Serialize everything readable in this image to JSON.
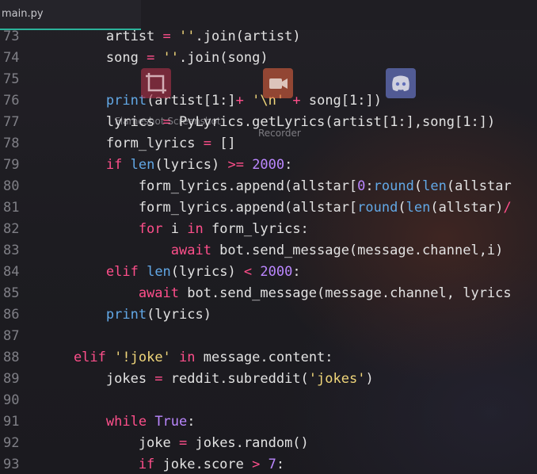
{
  "tab": {
    "filename": "main.py"
  },
  "desktop_icons": [
    {
      "name": "crop-icon",
      "label": "Flameshot Screenshot"
    },
    {
      "name": "camera-icon",
      "label": "Recorder"
    },
    {
      "name": "discord-icon",
      "label": ""
    }
  ],
  "lines": [
    {
      "num": "73",
      "segs": [
        [
          "var",
          "        artist "
        ],
        [
          "op",
          "="
        ],
        [
          "str",
          " ''"
        ],
        [
          "var",
          ".join(artist)"
        ]
      ]
    },
    {
      "num": "74",
      "segs": [
        [
          "var",
          "        song "
        ],
        [
          "op",
          "="
        ],
        [
          "str",
          " ''"
        ],
        [
          "var",
          ".join(song)"
        ]
      ]
    },
    {
      "num": "75",
      "segs": [
        [
          "var",
          ""
        ]
      ]
    },
    {
      "num": "76",
      "segs": [
        [
          "fn",
          "        print"
        ],
        [
          "var",
          "(artist[1:]"
        ],
        [
          "op",
          "+"
        ],
        [
          "var",
          " "
        ],
        [
          "str",
          "'\\n'"
        ],
        [
          "var",
          " "
        ],
        [
          "op",
          "+"
        ],
        [
          "var",
          " song[1:])"
        ]
      ]
    },
    {
      "num": "77",
      "segs": [
        [
          "var",
          "        lyrics "
        ],
        [
          "op",
          "="
        ],
        [
          "var",
          " PyLyrics.getLyrics(artist[1:],song[1:])"
        ]
      ]
    },
    {
      "num": "78",
      "segs": [
        [
          "var",
          "        form_lyrics "
        ],
        [
          "op",
          "="
        ],
        [
          "var",
          " []"
        ]
      ]
    },
    {
      "num": "79",
      "segs": [
        [
          "kw",
          "        if"
        ],
        [
          "var",
          " "
        ],
        [
          "fn",
          "len"
        ],
        [
          "var",
          "(lyrics) "
        ],
        [
          "op",
          ">="
        ],
        [
          "var",
          " "
        ],
        [
          "num",
          "2000"
        ],
        [
          "var",
          ":"
        ]
      ]
    },
    {
      "num": "80",
      "segs": [
        [
          "var",
          "            form_lyrics.append(allstar["
        ],
        [
          "num",
          "0"
        ],
        [
          "var",
          ":"
        ],
        [
          "fn",
          "round"
        ],
        [
          "var",
          "("
        ],
        [
          "fn",
          "len"
        ],
        [
          "var",
          "(allstar"
        ]
      ]
    },
    {
      "num": "81",
      "segs": [
        [
          "var",
          "            form_lyrics.append(allstar["
        ],
        [
          "fn",
          "round"
        ],
        [
          "var",
          "("
        ],
        [
          "fn",
          "len"
        ],
        [
          "var",
          "(allstar)"
        ],
        [
          "op",
          "/"
        ]
      ]
    },
    {
      "num": "82",
      "segs": [
        [
          "kw",
          "            for"
        ],
        [
          "var",
          " i "
        ],
        [
          "kw",
          "in"
        ],
        [
          "var",
          " form_lyrics:"
        ]
      ]
    },
    {
      "num": "83",
      "segs": [
        [
          "kw",
          "                await"
        ],
        [
          "var",
          " bot.send_message(message.channel,i)"
        ]
      ]
    },
    {
      "num": "84",
      "segs": [
        [
          "kw",
          "        elif"
        ],
        [
          "var",
          " "
        ],
        [
          "fn",
          "len"
        ],
        [
          "var",
          "(lyrics) "
        ],
        [
          "op",
          "<"
        ],
        [
          "var",
          " "
        ],
        [
          "num",
          "2000"
        ],
        [
          "var",
          ":"
        ]
      ]
    },
    {
      "num": "85",
      "segs": [
        [
          "kw",
          "            await"
        ],
        [
          "var",
          " bot.send_message(message.channel, lyrics"
        ]
      ]
    },
    {
      "num": "86",
      "segs": [
        [
          "fn",
          "        print"
        ],
        [
          "var",
          "(lyrics)"
        ]
      ]
    },
    {
      "num": "87",
      "segs": [
        [
          "var",
          ""
        ]
      ]
    },
    {
      "num": "88",
      "segs": [
        [
          "kw",
          "    elif"
        ],
        [
          "var",
          " "
        ],
        [
          "str",
          "'!joke'"
        ],
        [
          "var",
          " "
        ],
        [
          "kw",
          "in"
        ],
        [
          "var",
          " message.content:"
        ]
      ]
    },
    {
      "num": "89",
      "segs": [
        [
          "var",
          "        jokes "
        ],
        [
          "op",
          "="
        ],
        [
          "var",
          " reddit.subreddit("
        ],
        [
          "str",
          "'jokes'"
        ],
        [
          "var",
          ")"
        ]
      ]
    },
    {
      "num": "90",
      "segs": [
        [
          "var",
          ""
        ]
      ]
    },
    {
      "num": "91",
      "segs": [
        [
          "kw",
          "        while"
        ],
        [
          "var",
          " "
        ],
        [
          "num",
          "True"
        ],
        [
          "var",
          ":"
        ]
      ]
    },
    {
      "num": "92",
      "segs": [
        [
          "var",
          "            joke "
        ],
        [
          "op",
          "="
        ],
        [
          "var",
          " jokes.random()"
        ]
      ]
    },
    {
      "num": "93",
      "segs": [
        [
          "kw",
          "            if"
        ],
        [
          "var",
          " joke.score "
        ],
        [
          "op",
          ">"
        ],
        [
          "var",
          " "
        ],
        [
          "num",
          "7"
        ],
        [
          "var",
          ":"
        ]
      ]
    }
  ],
  "colors": {
    "keyword": "#ff4f8b",
    "function": "#62a8e6",
    "number": "#bb87ff",
    "string": "#f0d67a",
    "text": "#e2e2e2",
    "line_number": "#7f7f86",
    "tab_underline": "#2bb39a"
  }
}
